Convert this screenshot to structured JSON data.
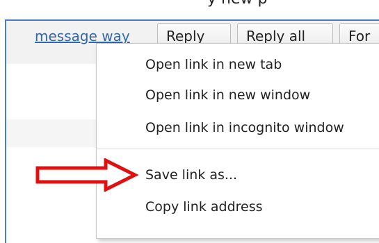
{
  "top_text": "y new p",
  "message": {
    "link_label": "message way"
  },
  "toolbar": {
    "reply_label": "Reply",
    "reply_all_label": "Reply all",
    "forward_label": "For"
  },
  "context_menu": {
    "items": [
      {
        "label": "Open link in new tab"
      },
      {
        "label": "Open link in new window"
      },
      {
        "label": "Open link in incognito window"
      },
      {
        "label": "Save link as..."
      },
      {
        "label": "Copy link address"
      }
    ]
  },
  "annotation": {
    "arrow_color": "#e01010",
    "points_to": "Save link as..."
  }
}
